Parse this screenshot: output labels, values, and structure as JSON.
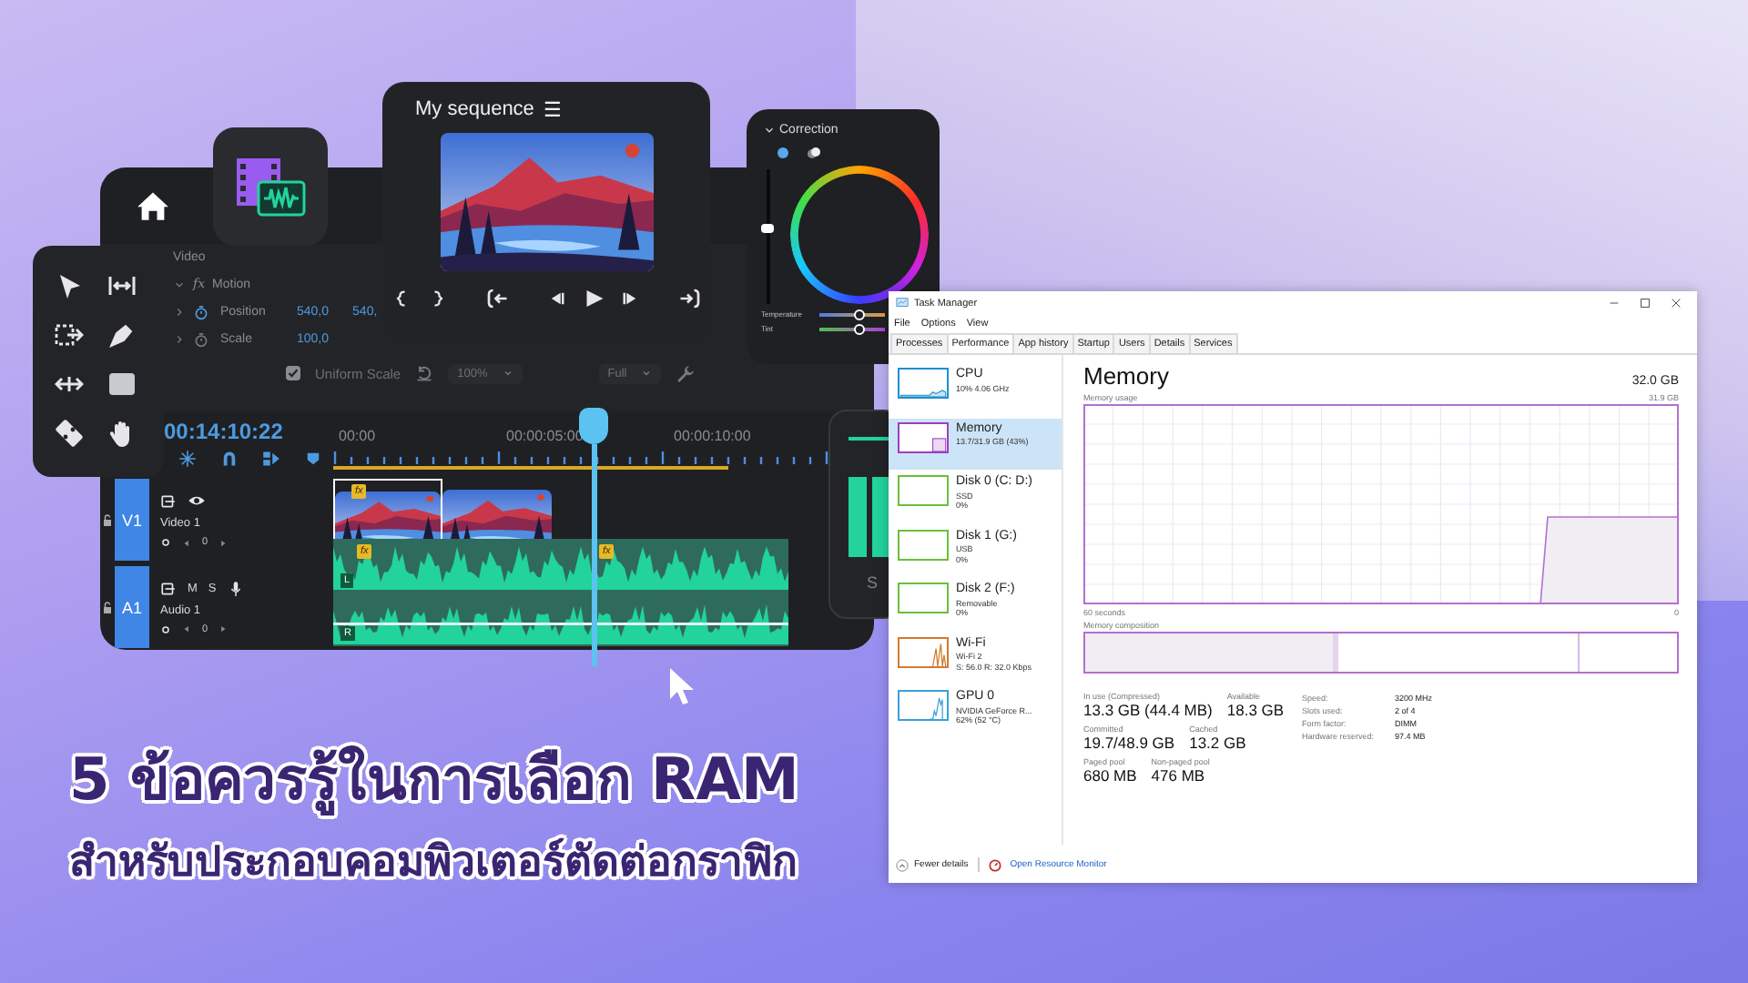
{
  "editor": {
    "effect_controls": {
      "section": "Video",
      "fx_label": "fx",
      "effect": "Motion",
      "properties": [
        {
          "name": "Position",
          "values": [
            "540,0",
            "540,"
          ]
        },
        {
          "name": "Scale",
          "values": [
            "100,0"
          ]
        }
      ],
      "uniform_scale": {
        "label": "Uniform Scale",
        "checked": true
      },
      "zoom_dropdown": "100%",
      "quality_dropdown": "Full"
    },
    "timeline": {
      "timecode": "00:14:10:22",
      "ruler_labels": [
        "00:00",
        "00:00:05:00",
        "00:00:10:00"
      ],
      "tracks": [
        {
          "kind": "video",
          "badge": "V1",
          "name": "Video 1",
          "value": "0",
          "clip_badges": [
            "fx"
          ]
        },
        {
          "kind": "audio",
          "badge": "A1",
          "name": "Audio 1",
          "buttons": [
            "M",
            "S"
          ],
          "value": "0",
          "clip_badges": [
            "fx",
            "fx"
          ],
          "channels": [
            "L",
            "R"
          ]
        }
      ]
    }
  },
  "sequence_monitor": {
    "title": "My sequence",
    "menu_glyph": "☰"
  },
  "correction_panel": {
    "title": "Correction",
    "lightness": {
      "level": 0.55
    },
    "sliders": [
      {
        "label": "Temperature",
        "level": 0.62
      },
      {
        "label": "Tint",
        "level": 0.62
      }
    ]
  },
  "meters_panel": {
    "label": "S"
  },
  "task_manager": {
    "title": "Task Manager",
    "menu": [
      "File",
      "Options",
      "View"
    ],
    "tabs": [
      {
        "label": "Processes",
        "selected": false
      },
      {
        "label": "Performance",
        "selected": true
      },
      {
        "label": "App history",
        "selected": false
      },
      {
        "label": "Startup",
        "selected": false
      },
      {
        "label": "Users",
        "selected": false
      },
      {
        "label": "Details",
        "selected": false
      },
      {
        "label": "Services",
        "selected": false
      }
    ],
    "sidebar": [
      {
        "kind": "cpu",
        "name": "CPU",
        "lines": [
          "10% 4.06 GHz"
        ],
        "color": "#1f8fd0",
        "selected": false
      },
      {
        "kind": "memory",
        "name": "Memory",
        "lines": [
          "13.7/31.9 GB (43%)"
        ],
        "color": "#9b3fc0",
        "selected": true
      },
      {
        "kind": "disk",
        "name": "Disk 0 (C: D:)",
        "lines": [
          "SSD",
          "0%"
        ],
        "color": "#6abf3a",
        "selected": false
      },
      {
        "kind": "disk",
        "name": "Disk 1 (G:)",
        "lines": [
          "USB",
          "0%"
        ],
        "color": "#6abf3a",
        "selected": false
      },
      {
        "kind": "disk",
        "name": "Disk 2 (F:)",
        "lines": [
          "Removable",
          "0%"
        ],
        "color": "#6abf3a",
        "selected": false
      },
      {
        "kind": "network",
        "name": "Wi-Fi",
        "lines": [
          "Wi-Fi 2",
          "S: 56.0 R: 32.0 Kbps"
        ],
        "color": "#d27a2e",
        "selected": false
      },
      {
        "kind": "gpu",
        "name": "GPU 0",
        "lines": [
          "NVIDIA GeForce R...",
          "62% (52 °C)"
        ],
        "color": "#3aa0d8",
        "selected": false
      }
    ],
    "heading": "Memory",
    "capacity": "32.0 GB",
    "usage_label": "Memory usage",
    "usage_max": "31.9 GB",
    "time_span": "60 seconds",
    "time_end": "0",
    "composition_label": "Memory composition",
    "stats": [
      {
        "label": "In use (Compressed)",
        "value": "13.3 GB (44.4 MB)"
      },
      {
        "label": "Available",
        "value": "18.3 GB"
      },
      {
        "label": "Committed",
        "value": "19.7/48.9 GB"
      },
      {
        "label": "Cached",
        "value": "13.2 GB"
      },
      {
        "label": "Paged pool",
        "value": "680 MB"
      },
      {
        "label": "Non-paged pool",
        "value": "476 MB"
      }
    ],
    "specs": [
      {
        "label": "Speed:",
        "value": "3200 MHz"
      },
      {
        "label": "Slots used:",
        "value": "2 of 4"
      },
      {
        "label": "Form factor:",
        "value": "DIMM"
      },
      {
        "label": "Hardware reserved:",
        "value": "97.4 MB"
      }
    ],
    "footer": {
      "toggle": "Fewer details",
      "link": "Open Resource Monitor"
    }
  },
  "headline": {
    "line_1": "5 ข้อควรรู้ในการเลือก RAM",
    "line_2": "สำหรับประกอบคอมพิวเตอร์ตัดต่อกราฟิก"
  }
}
